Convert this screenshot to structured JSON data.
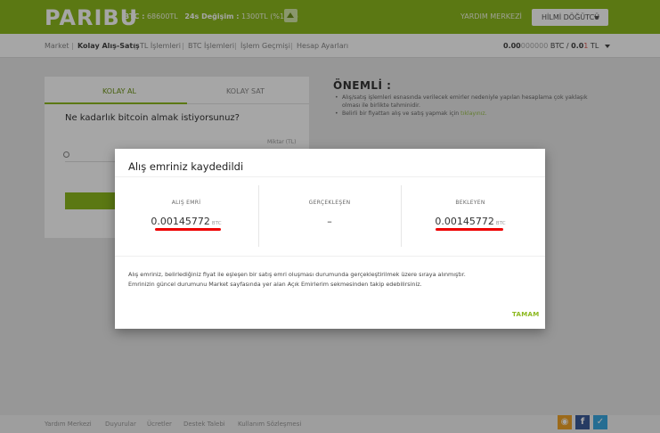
{
  "header": {
    "logo": "PARIBU",
    "ticker": {
      "btc_label": "BTC :",
      "btc_value": "68600TL",
      "change_label": "24s Değişim :",
      "change_value": "1300TL (%1.93)"
    },
    "help_label": "YARDIM MERKEZİ",
    "user_label": "HİLMİ DÖĞÜTCÜ"
  },
  "subnav": {
    "items": [
      "Market",
      "Kolay Alış-Satış",
      "TL İşlemleri",
      "BTC İşlemleri",
      "İşlem Geçmişi",
      "Hesap Ayarları"
    ],
    "balance": {
      "btc_bold": "0.00",
      "btc_faint": "000000",
      "btc_unit": " BTC / ",
      "tl_bold": "0.0",
      "tl_red": "1",
      "tl_unit": " TL"
    }
  },
  "trade_card": {
    "tab_buy": "KOLAY AL",
    "tab_sell": "KOLAY SAT",
    "question": "Ne kadarlık bitcoin almak istiyorsunuz?",
    "amount_label": "Miktar (TL)"
  },
  "notice": {
    "title": "ÖNEMLİ :",
    "item1": "Alış/satış işlemleri esnasında verilecek emirler nedeniyle yapılan hesaplama çok yaklaşık olması ile birlikte tahminidir.",
    "item2_prefix": "Belirli bir fiyattan alış ve satış yapmak için ",
    "item2_link": "tıklayınız."
  },
  "modal": {
    "title": "Alış emriniz kaydedildi",
    "columns": [
      {
        "title": "ALIŞ EMRİ",
        "value": "0.00145772",
        "unit": "BTC"
      },
      {
        "title": "GERÇEKLEŞEN",
        "value": "–",
        "unit": ""
      },
      {
        "title": "BEKLEYEN",
        "value": "0.00145772",
        "unit": "BTC"
      }
    ],
    "message_line1": "Alış emriniz, belirlediğiniz fiyat ile eşleşen bir satış emri oluşması durumunda gerçekleştirilmek üzere sıraya alınmıştır.",
    "message_line2": "Emrinizin güncel durumunu Market sayfasında yer alan Açık Emirlerim sekmesinden takip edebilirsiniz.",
    "ok_label": "TAMAM"
  },
  "footer": {
    "links": [
      "Yardım Merkezi",
      "Duyurular",
      "Ücretler",
      "Destek Talebi",
      "Kullanım Sözleşmesi"
    ],
    "social": {
      "rss": "rss-icon",
      "facebook": "facebook-icon",
      "twitter": "twitter-icon"
    }
  },
  "colors": {
    "brand": "#8cb81e",
    "accent_red": "#e00000"
  }
}
